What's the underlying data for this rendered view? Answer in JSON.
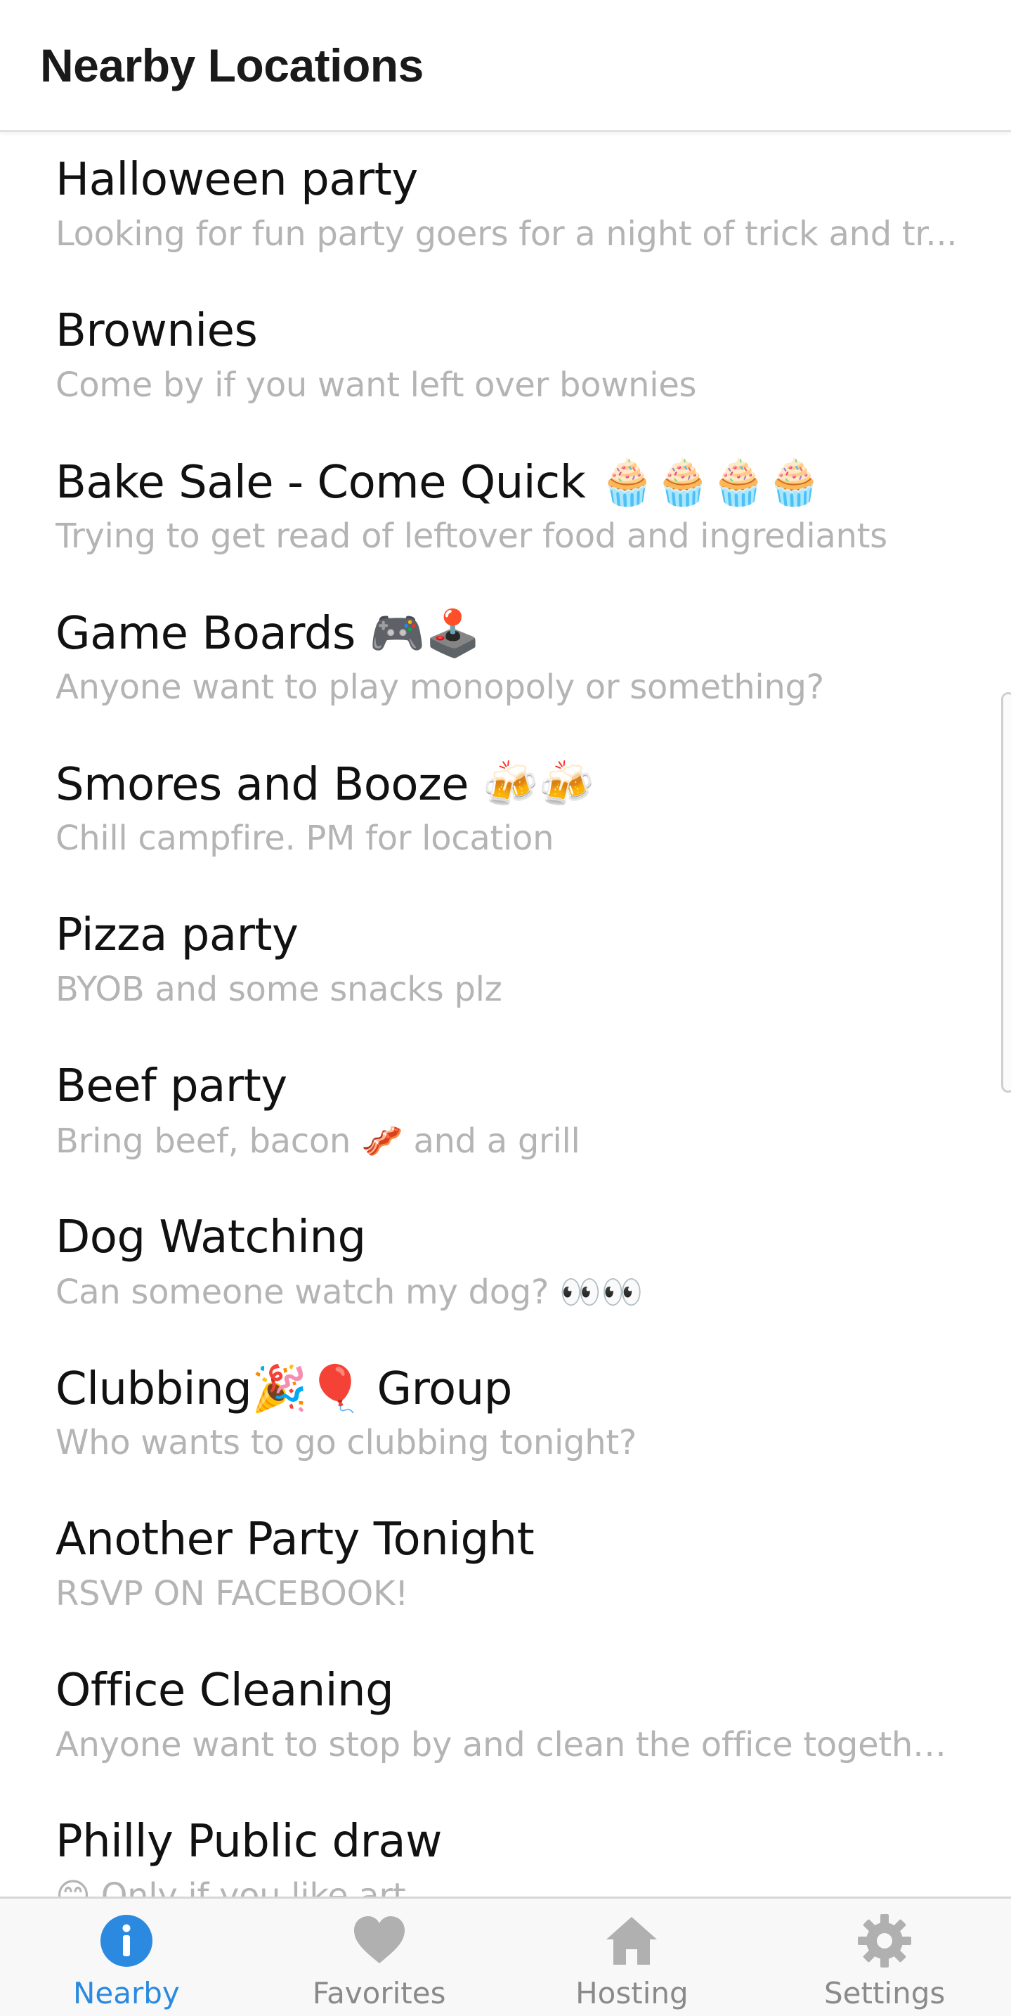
{
  "header": {
    "title": "Nearby Locations"
  },
  "colors": {
    "accent": "#2b8ae0",
    "inactive": "#a8a8a8",
    "title_text": "#111111",
    "subtitle_text": "#b4b4b4",
    "tabbar_bg": "#f8f8f8"
  },
  "locations": [
    {
      "title": "Halloween party",
      "subtitle": "Looking for fun party goers for a night of trick and tr..."
    },
    {
      "title": "Brownies",
      "subtitle": "Come by if you want left over bownies"
    },
    {
      "title": "Bake Sale - Come Quick 🧁🧁🧁🧁",
      "subtitle": "Trying to get read of leftover food and ingrediants"
    },
    {
      "title": "Game Boards 🎮🕹️",
      "subtitle": "Anyone want to play monopoly or something?"
    },
    {
      "title": "Smores and Booze 🍻🍻",
      "subtitle": "Chill campfire. PM for location"
    },
    {
      "title": "Pizza party",
      "subtitle": "BYOB and some snacks plz"
    },
    {
      "title": "Beef party",
      "subtitle": "Bring beef, bacon 🥓 and a grill"
    },
    {
      "title": "Dog Watching",
      "subtitle": "Can someone watch my dog? 👀👀"
    },
    {
      "title": "Clubbing🎉🎈 Group",
      "subtitle": "Who wants to go clubbing tonight?"
    },
    {
      "title": "Another Party Tonight",
      "subtitle": "RSVP ON FACEBOOK!"
    },
    {
      "title": "Office Cleaning",
      "subtitle": "Anyone want to stop by and clean the office together?"
    },
    {
      "title": "Philly Public draw",
      "subtitle": "😊 Only if you like art"
    }
  ],
  "tabs": [
    {
      "label": "Nearby",
      "icon": "info-icon",
      "active": true
    },
    {
      "label": "Favorites",
      "icon": "heart-icon",
      "active": false
    },
    {
      "label": "Hosting",
      "icon": "home-icon",
      "active": false
    },
    {
      "label": "Settings",
      "icon": "gear-icon",
      "active": false
    }
  ]
}
